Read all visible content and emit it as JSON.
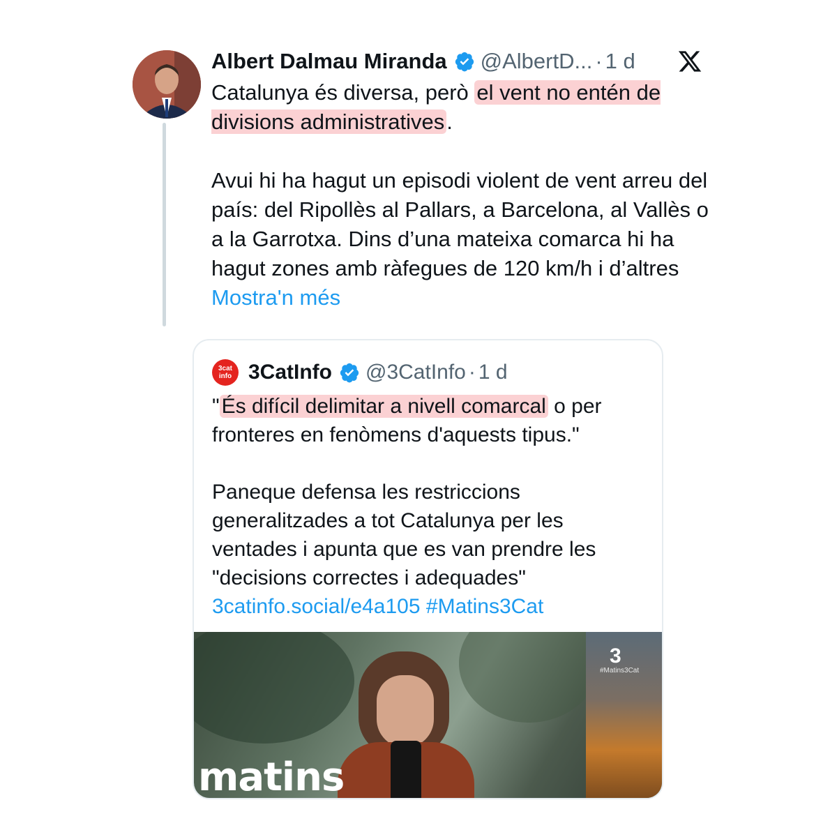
{
  "tweet": {
    "author_name": "Albert Dalmau Miranda",
    "handle": "@AlbertD...",
    "separator": "·",
    "time": "1 d",
    "text_1_plain": "Catalunya és diversa, però ",
    "text_1_highlight": "el vent no entén de divisions administratives",
    "text_1_end": ".",
    "text_2": "Avui hi ha hagut un episodi violent de vent arreu del país: del Ripollès al Pallars, a Barcelona, al Vallès o a la Garrotxa. Dins d’una mateixa comarca hi ha hagut zones amb ràfegues de 120 km/h i d’altres ",
    "show_more": "Mostra'n més"
  },
  "quote": {
    "avatar_line1": "3cat",
    "avatar_line2": "info",
    "name": "3CatInfo",
    "handle": "@3CatInfo",
    "separator": "·",
    "time": "1 d",
    "text_1_open": "\"",
    "text_1_highlight": "És difícil delimitar a nivell comarcal",
    "text_1_rest": " o per fronteres en fenòmens d'aquests tipus.\"",
    "text_2": "Paneque defensa les restriccions generalitzades a tot Catalunya per les ventades i apunta que es van prendre les \"decisions correctes i adequades\"",
    "link": "3catinfo.social/e4a105",
    "hashtag": "#Matins3Cat",
    "media": {
      "show_name": "matins",
      "channel_mark": "3",
      "channel_tag": "#Matins3Cat"
    }
  },
  "colors": {
    "link": "#1d9bf0",
    "verified": "#1d9bf0",
    "highlight": "#f8b4b8",
    "muted": "#536471"
  },
  "icons": [
    "verified-badge-icon",
    "x-logo-icon"
  ]
}
